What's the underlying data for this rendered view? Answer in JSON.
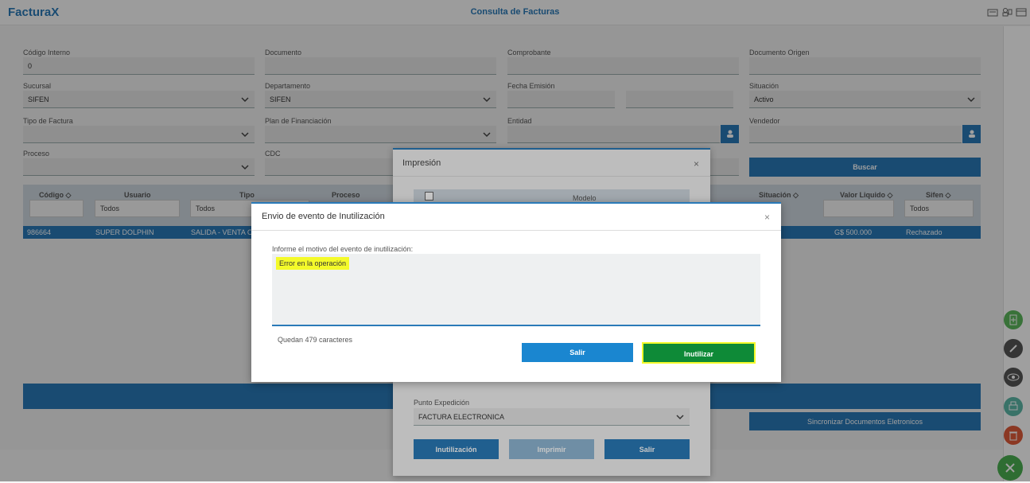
{
  "app": {
    "logo": "Factura",
    "logo_x": "X",
    "title": "Consulta de Facturas"
  },
  "form": {
    "codigo_interno": {
      "label": "Código Interno",
      "value": "0"
    },
    "documento": {
      "label": "Documento",
      "value": ""
    },
    "comprobante": {
      "label": "Comprobante",
      "value": ""
    },
    "documento_origen": {
      "label": "Documento Origen",
      "value": ""
    },
    "sucursal": {
      "label": "Sucursal",
      "value": "SIFEN"
    },
    "departamento": {
      "label": "Departamento",
      "value": "SIFEN"
    },
    "fecha_emision": {
      "label": "Fecha Emisión",
      "value": ""
    },
    "situacion": {
      "label": "Situación",
      "value": "Activo"
    },
    "tipo_factura": {
      "label": "Tipo de Factura",
      "value": ""
    },
    "plan_financiacion": {
      "label": "Plan de Financiación",
      "value": ""
    },
    "entidad": {
      "label": "Entidad",
      "value": ""
    },
    "vendedor": {
      "label": "Vendedor",
      "value": ""
    },
    "proceso": {
      "label": "Proceso",
      "value": ""
    },
    "cdc": {
      "label": "CDC",
      "value": ""
    },
    "buscar_label": "Buscar"
  },
  "table": {
    "headers": {
      "codigo": "Código",
      "usuario": "Usuario",
      "tipo": "Tipo",
      "proceso": "Proceso",
      "situacion": "Situación",
      "valor": "Valor Liquido",
      "sifen": "Sifen"
    },
    "filters": {
      "usuario": "Todos",
      "tipo": "Todos",
      "sifen": "Todos"
    },
    "row": {
      "codigo": "986664",
      "usuario": "SUPER DOLPHIN",
      "tipo": "SALIDA - VENTA C",
      "valor": "G$ 500.000",
      "sifen": "Rechazado"
    }
  },
  "sync_label": "Sincronizar Documentos Eletronicos",
  "impresion": {
    "title": "Impresión",
    "close": "×",
    "modelo_header": "Modelo",
    "punto_label": "Punto Expedición",
    "punto_value": "FACTURA ELECTRONICA",
    "btn_inut": "Inutilización",
    "btn_imprimir": "Imprimir",
    "btn_salir": "Salir"
  },
  "inut": {
    "title": "Envio de evento de Inutilización",
    "close": "×",
    "prompt": "Informe el motivo del evento de inutilización:",
    "reason": "Error en la operación",
    "remaining": "Quedan 479 caracteres",
    "btn_salir": "Salir",
    "btn_inutilizar": "Inutilizar"
  },
  "colors": {
    "primary": "#2a7ab8",
    "success": "#0e8a37",
    "highlight": "#f4fa2a",
    "danger": "#e05a3a"
  }
}
